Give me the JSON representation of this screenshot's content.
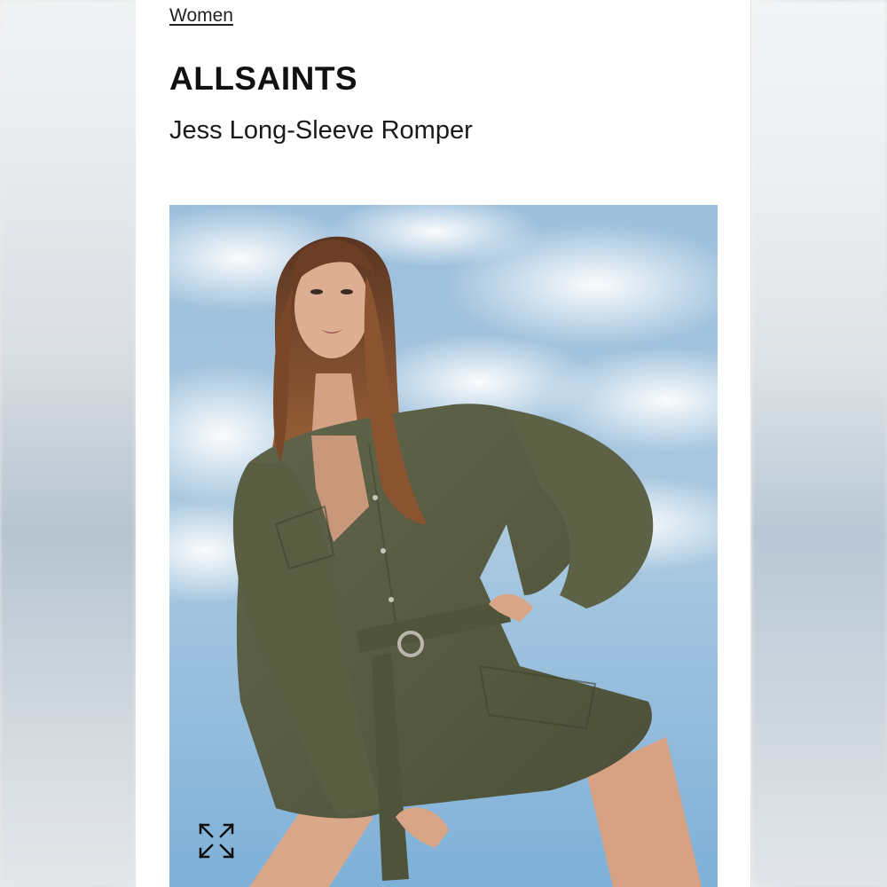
{
  "breadcrumb": {
    "label": "Women"
  },
  "product": {
    "brand": "ALLSAINTS",
    "name": "Jess Long-Sleeve Romper"
  },
  "colors": {
    "text": "#111111",
    "sky": "#8fb6d6",
    "romper": "#5a5e44",
    "hair": "#7a4a2a"
  },
  "icons": {
    "expand": "expand-arrows-icon"
  }
}
